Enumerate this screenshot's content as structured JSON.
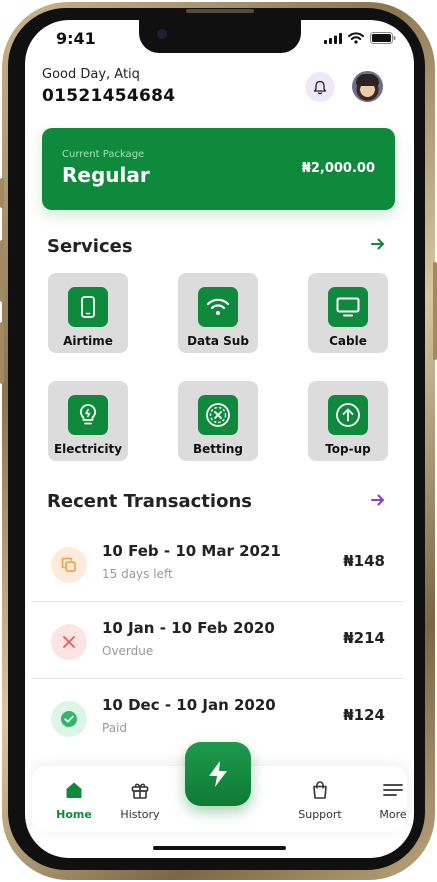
{
  "status_bar": {
    "time": "9:41"
  },
  "header": {
    "greeting": "Good Day, Atiq",
    "phone_number": "01521454684"
  },
  "package": {
    "label": "Current Package",
    "name": "Regular",
    "amount": "₦2,000.00"
  },
  "services": {
    "title": "Services",
    "items": [
      {
        "label": "Airtime",
        "icon": "phone-icon"
      },
      {
        "label": "Data Sub",
        "icon": "wifi-icon"
      },
      {
        "label": "Cable",
        "icon": "tv-icon"
      },
      {
        "label": "Electricity",
        "icon": "bulb-icon"
      },
      {
        "label": "Betting",
        "icon": "betting-icon"
      },
      {
        "label": "Top-up",
        "icon": "arrow-up-circle-icon"
      }
    ]
  },
  "transactions": {
    "title": "Recent Transactions",
    "items": [
      {
        "period": "10 Feb - 10 Mar 2021",
        "status": "15 days left",
        "amount": "₦148",
        "icon": "copy-icon",
        "color": "#f0a35a"
      },
      {
        "period": "10 Jan - 10 Feb 2020",
        "status": "Overdue",
        "amount": "₦214",
        "icon": "close-icon",
        "color": "#e25c5c"
      },
      {
        "period": "10 Dec - 10 Jan 2020",
        "status": "Paid",
        "amount": "₦124",
        "icon": "check-icon",
        "color": "#2fb866"
      }
    ]
  },
  "bottom_nav": {
    "items": [
      {
        "label": "Home",
        "active": true
      },
      {
        "label": "History"
      },
      {
        "label": "Support"
      },
      {
        "label": "More"
      }
    ]
  },
  "colors": {
    "brand_green": "#0f8a3c",
    "accent_purple": "#8a3ad8"
  }
}
